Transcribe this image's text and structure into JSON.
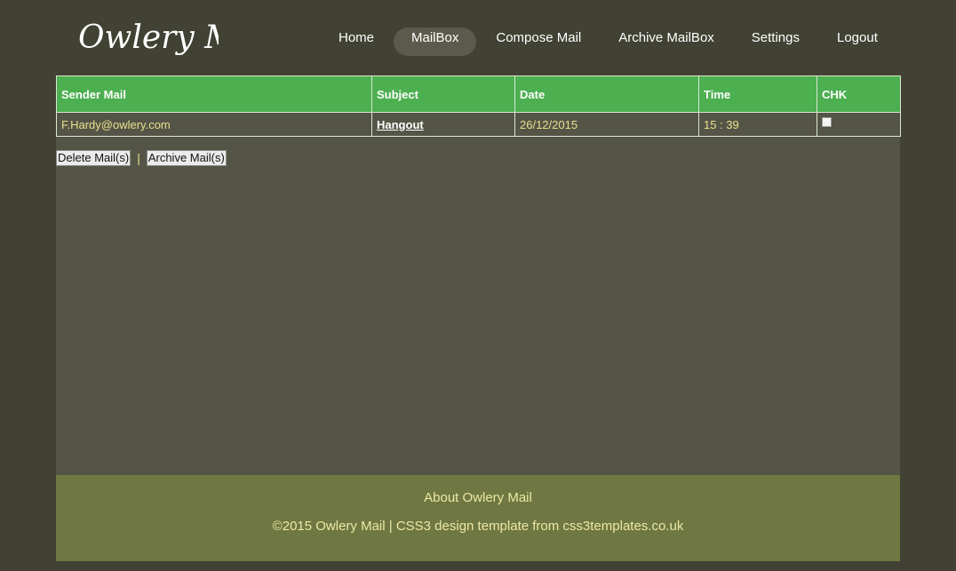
{
  "logo": {
    "text": "Owlery Mail"
  },
  "nav": {
    "items": [
      {
        "label": "Home"
      },
      {
        "label": "MailBox"
      },
      {
        "label": "Compose Mail"
      },
      {
        "label": "Archive MailBox"
      },
      {
        "label": "Settings"
      },
      {
        "label": "Logout"
      }
    ],
    "active": "MailBox"
  },
  "mailbox": {
    "columns": [
      "Sender Mail",
      "Subject",
      "Date",
      "Time",
      "CHK"
    ],
    "rows": [
      {
        "sender": "F.Hardy@owlery.com",
        "subject": "Hangout",
        "date": "26/12/2015",
        "time": "15 : 39",
        "checked": false
      }
    ]
  },
  "actions": {
    "delete_label": "Delete Mail(s)",
    "separator": "|",
    "archive_label": "Archive Mail(s)"
  },
  "footer": {
    "about": "About Owlery Mail",
    "copyright": "©2015 Owlery Mail | CSS3 design template from css3templates.co.uk"
  },
  "colors": {
    "page_background": "#414134",
    "content_background": "#555547",
    "table_header": "#4caf50",
    "cell_text": "#e6e08c",
    "footer_background": "#6f7742",
    "active_nav_pill": "#5c5a4c"
  }
}
